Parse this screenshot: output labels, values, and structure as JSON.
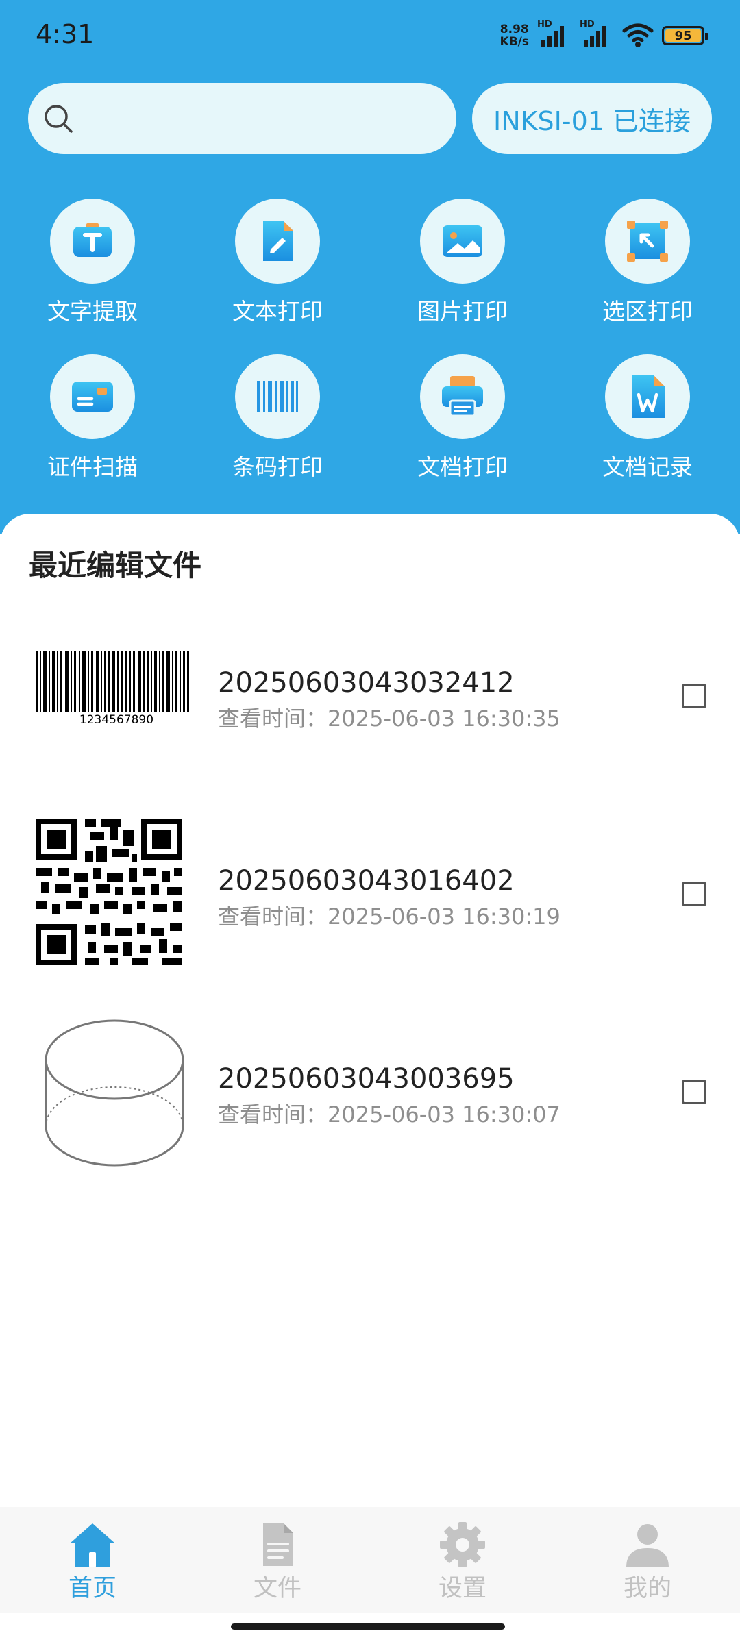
{
  "status_bar": {
    "time": "4:31",
    "net_speed_value": "8.98",
    "net_speed_unit": "KB/s",
    "signal_tag_1": "HD",
    "signal_tag_2": "HD",
    "battery": "95"
  },
  "search": {
    "placeholder": "",
    "icon": "search-icon"
  },
  "device_button": {
    "label": "INKSI-01 已连接"
  },
  "tools": [
    {
      "label": "文字提取",
      "icon": "text-extract-icon"
    },
    {
      "label": "文本打印",
      "icon": "text-print-icon"
    },
    {
      "label": "图片打印",
      "icon": "image-print-icon"
    },
    {
      "label": "选区打印",
      "icon": "area-print-icon"
    },
    {
      "label": "证件扫描",
      "icon": "id-scan-icon"
    },
    {
      "label": "条码打印",
      "icon": "barcode-print-icon"
    },
    {
      "label": "文档打印",
      "icon": "printer-icon"
    },
    {
      "label": "文档记录",
      "icon": "word-doc-icon"
    }
  ],
  "recent": {
    "title": "最近编辑文件",
    "time_prefix": "查看时间：",
    "files": [
      {
        "name": "20250603043032412",
        "time": "2025-06-03 16:30:35",
        "thumb": "barcode",
        "barcode_text": "1234567890",
        "checked": false
      },
      {
        "name": "20250603043016402",
        "time": "2025-06-03 16:30:19",
        "thumb": "qr-code",
        "checked": false
      },
      {
        "name": "20250603043003695",
        "time": "2025-06-03 16:30:07",
        "thumb": "cylinder-sketch",
        "checked": false
      }
    ]
  },
  "bottom_nav": {
    "active": 0,
    "items": [
      {
        "label": "首页",
        "icon": "home-icon"
      },
      {
        "label": "文件",
        "icon": "file-icon"
      },
      {
        "label": "设置",
        "icon": "gear-icon"
      },
      {
        "label": "我的",
        "icon": "user-icon"
      }
    ]
  },
  "colors": {
    "header_blue": "#2fa7e5",
    "pill_bg": "#e6f7fa",
    "accent_text": "#2aa0dc",
    "icon_gradient_top": "#3ec4f2",
    "icon_gradient_bottom": "#1b8fe0",
    "icon_orange": "#f5a24a",
    "nav_active": "#2f9fdd",
    "nav_inactive": "#c1c1c1"
  }
}
